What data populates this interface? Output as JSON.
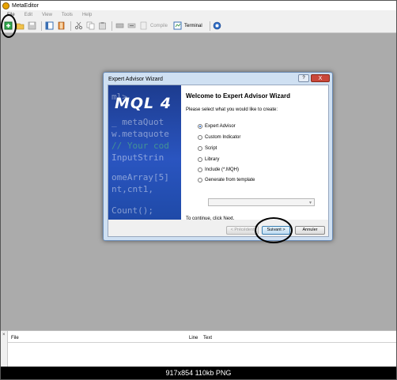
{
  "window": {
    "title": "MetaEditor"
  },
  "menu": [
    "File",
    "Edit",
    "View",
    "Tools",
    "Help"
  ],
  "toolbar": {
    "compile_label": "Compile",
    "terminal_label": "Terminal"
  },
  "dialog": {
    "title": "Expert Advisor Wizard",
    "help_label": "?",
    "close_label": "X",
    "banner": {
      "logo": "MQL 4",
      "code_lines": [
        "ml>",
        "_ metaQuot",
        "w.metaquote",
        "// Your cod",
        "InputStrin",
        "",
        "omeArray[5]",
        "nt,cnt1,",
        "",
        "Count();"
      ]
    },
    "heading": "Welcome to Expert Advisor Wizard",
    "prompt": "Please select what you would like to create:",
    "options": [
      {
        "label": "Expert Advisor",
        "selected": true
      },
      {
        "label": "Custom Indicator",
        "selected": false
      },
      {
        "label": "Script",
        "selected": false
      },
      {
        "label": "Library",
        "selected": false
      },
      {
        "label": "Include (*.MQH)",
        "selected": false
      },
      {
        "label": "Generate from template",
        "selected": false
      }
    ],
    "template_value": "",
    "continue_text": "To continue, click Next.",
    "buttons": {
      "back": "< Précédent",
      "next": "Suivant >",
      "cancel": "Annuler"
    }
  },
  "output": {
    "columns": {
      "file": "File",
      "line": "Line",
      "text": "Text"
    },
    "close_label": "×"
  },
  "caption": "917x854  110kb  PNG"
}
